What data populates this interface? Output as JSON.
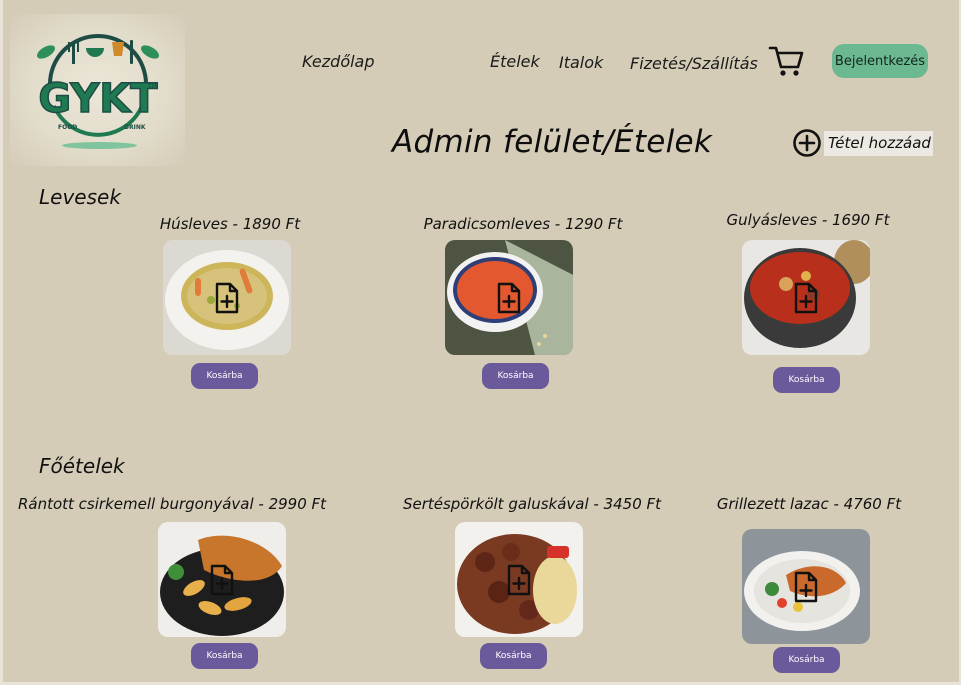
{
  "brand": {
    "logo_text": "GYKT",
    "logo_sub_left": "FOOD",
    "logo_sub_right": "DRINK",
    "logo_tm": "TM",
    "colors": {
      "green": "#1f7a52",
      "dark": "#1d4c44",
      "mint": "#6fbf97",
      "amber": "#d18a2a"
    }
  },
  "nav": {
    "home": "Kezdőlap",
    "foods": "Ételek",
    "drinks": "Italok",
    "payment": "Fizetés/Szállítás",
    "login": "Bejelentkezés",
    "cart_icon": "shopping-cart-icon"
  },
  "page": {
    "title": "Admin felület/Ételek",
    "add_item": "Tétel hozzáad"
  },
  "colors": {
    "background": "#d4ccb7",
    "login_button": "#6bb891",
    "cart_button": "#6a5a9c"
  },
  "sections": [
    {
      "title": "Levesek",
      "items": [
        {
          "title": "Húsleves - 1890 Ft",
          "button": "Kosárba",
          "image": "chicken-soup-photo"
        },
        {
          "title": "Paradicsomleves - 1290 Ft",
          "button": "Kosárba",
          "image": "tomato-soup-photo"
        },
        {
          "title": "Gulyásleves - 1690 Ft",
          "button": "Kosárba",
          "image": "goulash-soup-photo"
        }
      ]
    },
    {
      "title": "Főételek",
      "items": [
        {
          "title": "Rántott csirkemell burgonyával - 2990 Ft",
          "button": "Kosárba",
          "image": "breaded-chicken-potatoes-photo"
        },
        {
          "title": "Sertéspörkölt galuskával - 3450 Ft",
          "button": "Kosárba",
          "image": "pork-stew-dumplings-photo"
        },
        {
          "title": "Grillezett lazac - 4760 Ft",
          "button": "Kosárba",
          "image": "grilled-salmon-photo"
        }
      ]
    }
  ]
}
